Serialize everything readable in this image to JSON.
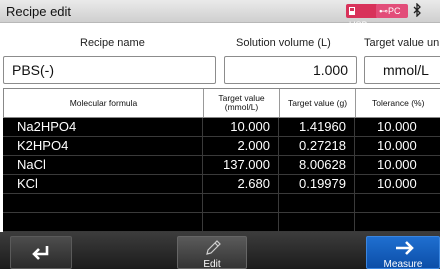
{
  "window": {
    "title": "Recipe edit",
    "status": {
      "usb_label": "USB",
      "pc_label": "PC",
      "bluetooth_icon": "bluetooth-icon"
    }
  },
  "form": {
    "recipe_name_label": "Recipe name",
    "solution_volume_label": "Solution volume (L)",
    "target_unit_label": "Target value un",
    "recipe_name": "PBS(-)",
    "solution_volume": "1.000",
    "target_unit": "mmol/L"
  },
  "table": {
    "headers": [
      "Molecular formula",
      "Target value (mmol/L)",
      "Target value (g)",
      "Tolerance (%)"
    ],
    "rows": [
      [
        "Na2HPO4",
        "10.000",
        "1.41960",
        "10.000"
      ],
      [
        "K2HPO4",
        "2.000",
        "0.27218",
        "10.000"
      ],
      [
        "NaCl",
        "137.000",
        "8.00628",
        "10.000"
      ],
      [
        "KCl",
        "2.680",
        "0.19979",
        "10.000"
      ],
      [
        "",
        "",
        "",
        ""
      ],
      [
        "",
        "",
        "",
        ""
      ]
    ]
  },
  "footer": {
    "back_icon": "return-arrow-icon",
    "edit_label": "Edit",
    "edit_icon": "pencil-icon",
    "measure_label": "Measure",
    "measure_icon": "arrow-right-icon"
  },
  "colors": {
    "usb_badge": "#d8325a",
    "pc_badge": "#e24d79",
    "measure_button": "#1661c2",
    "table_background": "#000000"
  }
}
